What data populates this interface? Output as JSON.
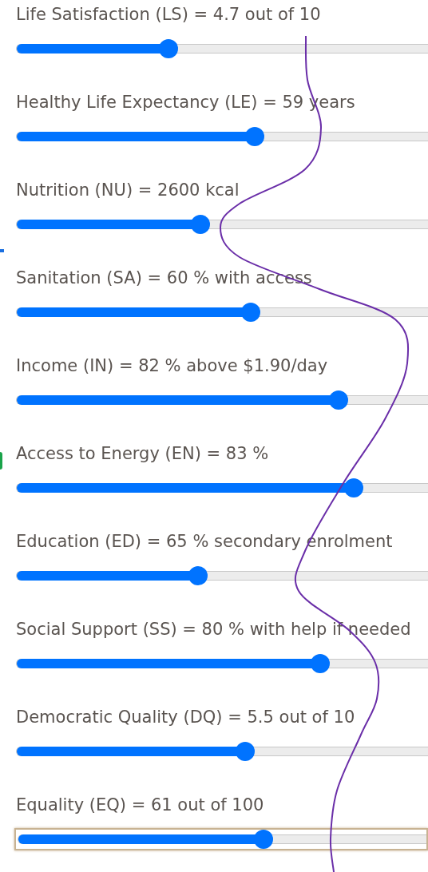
{
  "sliders": [
    {
      "label": "Life Satisfaction (LS) = 4.7 out of 10",
      "level": 0.368,
      "focused": false
    },
    {
      "label": "Healthy Life Expectancy (LE) = 59 years",
      "level": 0.578,
      "focused": false
    },
    {
      "label": "Nutrition (NU) = 2600 kcal",
      "level": 0.446,
      "focused": false
    },
    {
      "label": "Sanitation (SA) = 60 % with access",
      "level": 0.568,
      "focused": false
    },
    {
      "label": "Income (IN) = 82 % above $1.90/day",
      "level": 0.783,
      "focused": false
    },
    {
      "label": "Access to Energy (EN) = 83 %",
      "level": 0.82,
      "focused": false
    },
    {
      "label": "Education (ED) = 65 % secondary enrolment",
      "level": 0.44,
      "focused": false
    },
    {
      "label": "Social Support (SS) = 80 % with help if needed",
      "level": 0.738,
      "focused": false
    },
    {
      "label": "Democratic Quality (DQ) = 5.5 out of 10",
      "level": 0.556,
      "focused": false
    },
    {
      "label": "Equality (EQ) = 61 out of 100",
      "level": 0.6,
      "focused": true
    }
  ]
}
